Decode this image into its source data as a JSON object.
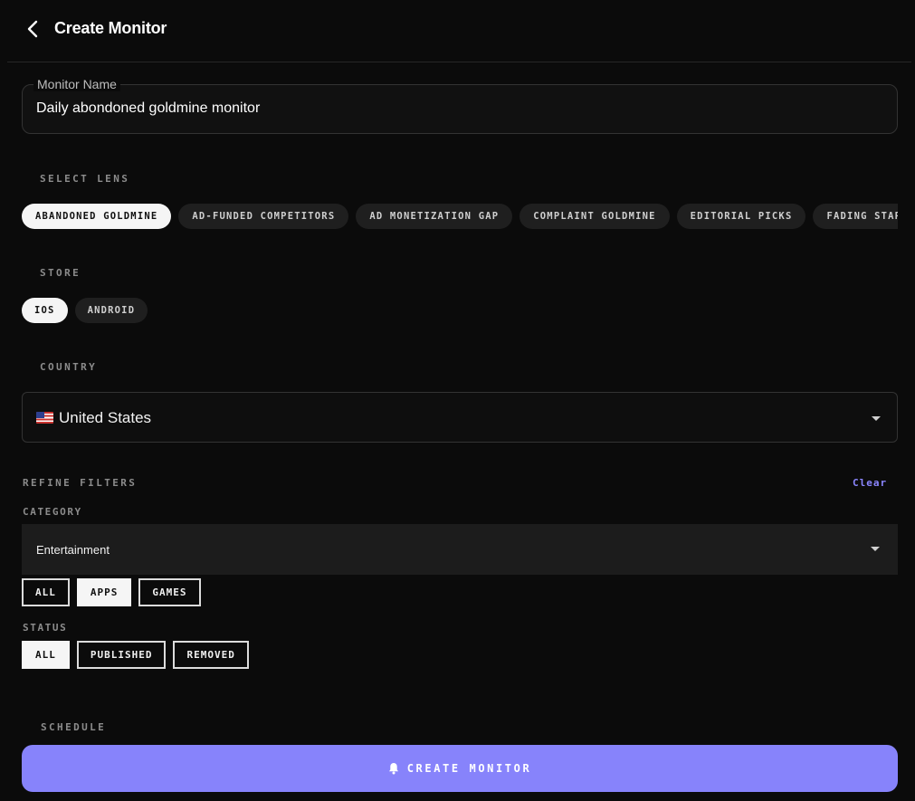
{
  "header": {
    "title": "Create Monitor",
    "back_icon": "chevron-left-icon"
  },
  "monitor_name": {
    "label": "Monitor Name",
    "value": "Daily abondoned goldmine monitor"
  },
  "lens": {
    "label": "SELECT LENS",
    "options": [
      "ABANDONED GOLDMINE",
      "AD-FUNDED COMPETITORS",
      "AD MONETIZATION GAP",
      "COMPLAINT GOLDMINE",
      "EDITORIAL PICKS",
      "FADING STAR"
    ],
    "selected": "ABANDONED GOLDMINE"
  },
  "store": {
    "label": "STORE",
    "options": [
      "IOS",
      "ANDROID"
    ],
    "selected": "IOS"
  },
  "country": {
    "label": "COUNTRY",
    "value": "United States",
    "flag_icon": "us-flag-icon"
  },
  "refine": {
    "label": "REFINE FILTERS",
    "clear_label": "Clear",
    "category_label": "CATEGORY",
    "category_value": "Entertainment",
    "type_options": [
      "ALL",
      "APPS",
      "GAMES"
    ],
    "type_selected": "APPS",
    "status_label": "STATUS",
    "status_options": [
      "ALL",
      "PUBLISHED",
      "REMOVED"
    ],
    "status_selected": "ALL"
  },
  "schedule": {
    "label": "SCHEDULE"
  },
  "create_button": {
    "label": "CREATE MONITOR",
    "icon": "bell-icon"
  },
  "colors": {
    "background": "#0b0b0b",
    "accent": "#8783fb",
    "link": "#8b86ff",
    "chip_bg": "#1f1f1f",
    "chip_active_bg": "#f5f5f5"
  }
}
